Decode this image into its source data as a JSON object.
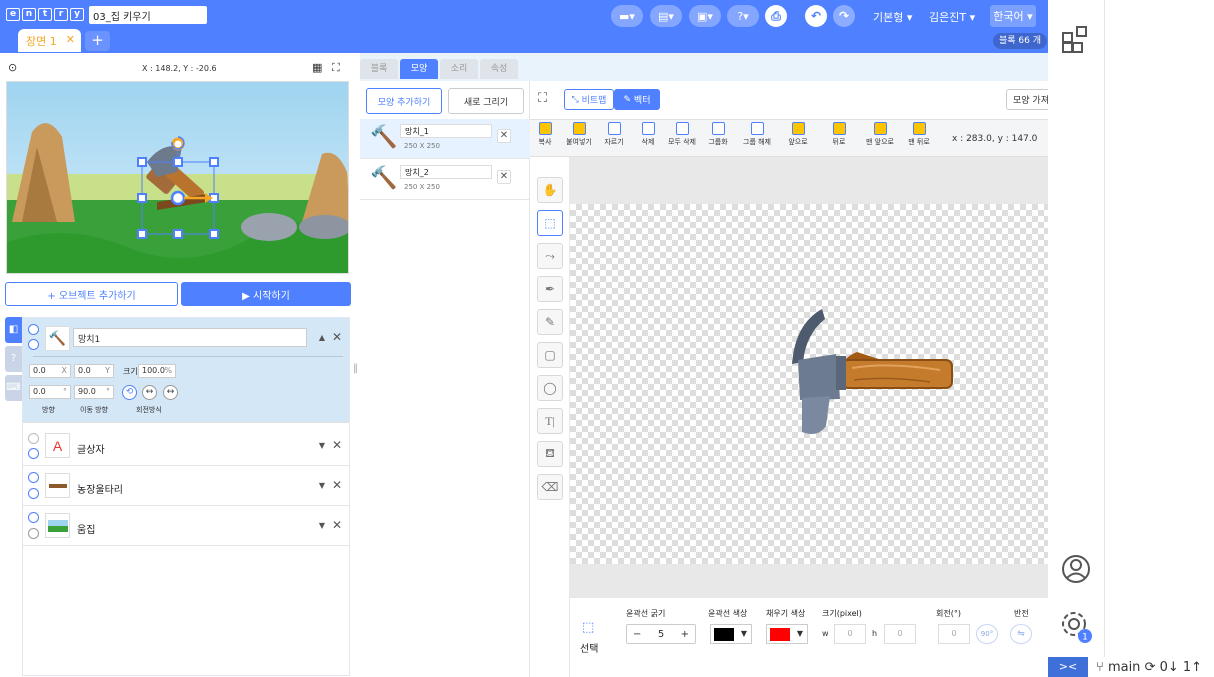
{
  "header": {
    "logo_letters": [
      "e",
      "n",
      "t",
      "r",
      "y"
    ],
    "project_name": "03_집 키우기",
    "mode_label": "기본형 ▾",
    "user_label": "김은진T ▾",
    "lang_label": "한국어 ▾",
    "scene_tab": "장면 1",
    "scene_add": "+",
    "block_count": "블록 66 개"
  },
  "stage": {
    "coords": "X : 148.2, Y : -20.6"
  },
  "left": {
    "add_object": "+ 오브젝트 추가하기",
    "start": "▶ 시작하기"
  },
  "objects": {
    "selected": {
      "name": "망치1",
      "x": "0.0",
      "y": "0.0",
      "size_label": "크기",
      "size": "100.0",
      "direction": "0.0",
      "move_direction": "90.0",
      "lbl_direction": "방향",
      "lbl_move_direction": "이동 방향",
      "lbl_rotation": "회전방식",
      "unit_x": "X",
      "unit_y": "Y",
      "unit_pct": "%",
      "unit_deg": "°"
    },
    "rows": [
      {
        "name": "글상자"
      },
      {
        "name": "농장울타리"
      },
      {
        "name": "움집"
      }
    ]
  },
  "tabs": [
    "블록",
    "모양",
    "소리",
    "속성"
  ],
  "shapes": {
    "add_btn": "모양 추가하기",
    "draw_btn": "새로 그리기",
    "items": [
      {
        "name": "망치_1",
        "size": "250 X 250"
      },
      {
        "name": "망치_2",
        "size": "250 X 250"
      }
    ]
  },
  "editor": {
    "bitmap": "비트맵",
    "vector": "벡터",
    "import_label": "모양 가져",
    "toolbar": [
      "복사",
      "붙여넣기",
      "자르기",
      "삭제",
      "모두 삭제",
      "그룹화",
      "그룹 해제",
      "앞으로",
      "뒤로",
      "맨 앞으로",
      "맨 뒤로"
    ],
    "coord_readout": "x : 283.0, y : 147.0",
    "props": {
      "select_label": "선택",
      "stroke_width_label": "윤곽선 굵기",
      "stroke_width": "5",
      "stroke_color_label": "윤곽선 색상",
      "fill_color_label": "채우기 색상",
      "size_label": "크기(pixel)",
      "w_label": "w",
      "h_label": "h",
      "w_value": "0",
      "h_value": "0",
      "rotation_label": "회전(°)",
      "rotation_value": "0",
      "rotation_btn": "90°",
      "flip_label": "반전"
    },
    "colors": {
      "stroke": "#000000",
      "fill": "#ff0000"
    }
  },
  "status_bar": {
    "branch": "main",
    "sync": "0↓ 1↑"
  },
  "accent": "#4f80ff"
}
